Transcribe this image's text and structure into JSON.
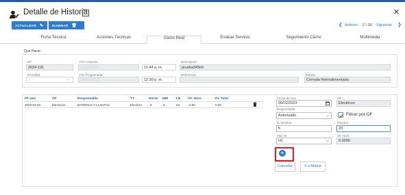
{
  "header": {
    "title": "Detalle de Historia",
    "close": "×"
  },
  "actions": {
    "update_label": "ACTUALIZAR",
    "delete_label": "ELIMINAR"
  },
  "nav": {
    "prev_label": "Anterior",
    "count": "2 / 36",
    "next_label": "Siguiente"
  },
  "tabs": [
    "Ficha Técnica",
    "Acciones Técnicas",
    "Gasto Real",
    "Evaluar Servicio",
    "Seguimiento Cierre",
    "Multimedia"
  ],
  "que_hacer": {
    "section_label": "Que Hacer",
    "ot_label": "OT",
    "ot_value": "2024-191",
    "fh_creacion_label": "F/H Creación",
    "fh_creacion_date": "13/02/2023",
    "fh_creacion_time": "11:44 a. m.",
    "descripcion_label": "Descripción",
    "descripcion_value": "prueba345hh",
    "prioridad_label": "Prioridad",
    "prioridad_value": "1",
    "fh_programada_label": "F/H Programada",
    "fh_programada_date": "13/02/2023",
    "fh_programada_time": "12:30 p. m.",
    "referencia_label": "Referencia",
    "referencia_value": "",
    "estado_label": "Estado",
    "estado_value": "Cerrada Retroalimentada"
  },
  "table": {
    "headers": [
      "FF Uso",
      "OF",
      "Responsable",
      "TT",
      "Horas",
      "MM",
      "T.H.",
      "Vlr. Hora",
      "Vlr. Total"
    ],
    "rows": [
      [
        "2023-02-03",
        "Electricos",
        "BATERIAS Y LLANTAS",
        "Electrico",
        "9",
        "9",
        "H1",
        "0.00",
        "0.00"
      ]
    ]
  },
  "form": {
    "fecha_uso_label": "Fecha de Uso",
    "fecha_uso_value": "06/02/2023",
    "of_label": "OF",
    "of_value": "Electricos",
    "responsable_label": "Responsable",
    "responsable_value": "Autorizado",
    "filtrar_label": "Filtrar por OF",
    "nombre_label": "N. Nombre",
    "nombre_value": "5",
    "minutos_label": "Minutos",
    "minutos_value": "20",
    "tipo_hr_label": "Tipo Hr.",
    "tipo_hr_value": "H1",
    "vlr_hora_label": "Vlr. Hora",
    "vlr_hora_value": "0.0000",
    "cancel_label": "Cancelar",
    "matrix_label": "Ir a Matriz",
    "add_glyph": "+"
  },
  "colors": {
    "accent": "#2b7cd3",
    "highlight_box": "#e02020",
    "top_bar": "#1f5fa8"
  }
}
